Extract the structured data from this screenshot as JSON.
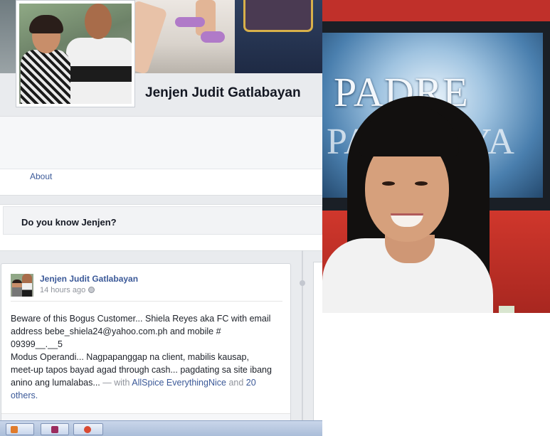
{
  "profile": {
    "name": "Jenjen Judit Gatlabayan"
  },
  "nav": {
    "about_label": "About"
  },
  "know_card": {
    "title": "Do you know Jenjen?"
  },
  "post": {
    "author": "Jenjen Judit Gatlabayan",
    "timestamp": "14 hours ago",
    "line1": "Beware of this Bogus Customer... Shiela Reyes aka FC with email",
    "line2": "address bebe_shiela24@yahoo.com.ph and mobile #",
    "line3": "09399__.__5",
    "line4": "Modus Operandi... Nagpapanggap na client, mabilis kausap,",
    "line5": "meet-up tapos bayad agad through cash... pagdating sa site ibang",
    "line6_text": "anino ang lumalabas...",
    "with_label": "— with",
    "tagged_person": "AllSpice EverythingNice",
    "and_label": "and",
    "others_count": "20",
    "others_label": "others."
  },
  "photo": {
    "tv_text_line1": "PADRE",
    "tv_text_line2": "PASENCYA"
  },
  "colors": {
    "link": "#3b5998",
    "background": "#e9ebee",
    "text": "#141823",
    "muted": "#90949c"
  },
  "icons": {
    "privacy": "globe-icon"
  }
}
